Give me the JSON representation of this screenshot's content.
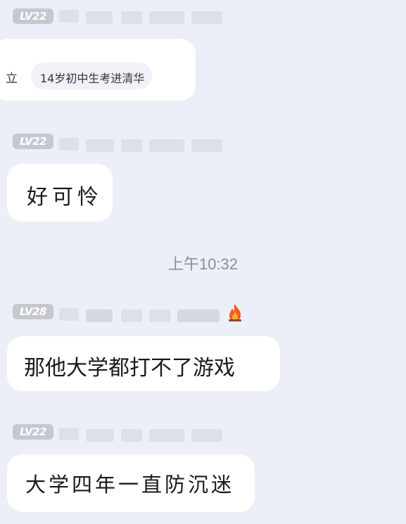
{
  "messages": [
    {
      "level": "LV22",
      "text": "14岁初中生考进清华",
      "cut_text": "立"
    },
    {
      "level": "LV22",
      "text": "好可怜"
    },
    {
      "level": "LV28",
      "text": "那他大学都打不了游戏",
      "badge_icon": "fire-icon"
    },
    {
      "level": "LV22",
      "text": "大学四年一直防沉迷"
    }
  ],
  "timestamp": "上午10:32"
}
